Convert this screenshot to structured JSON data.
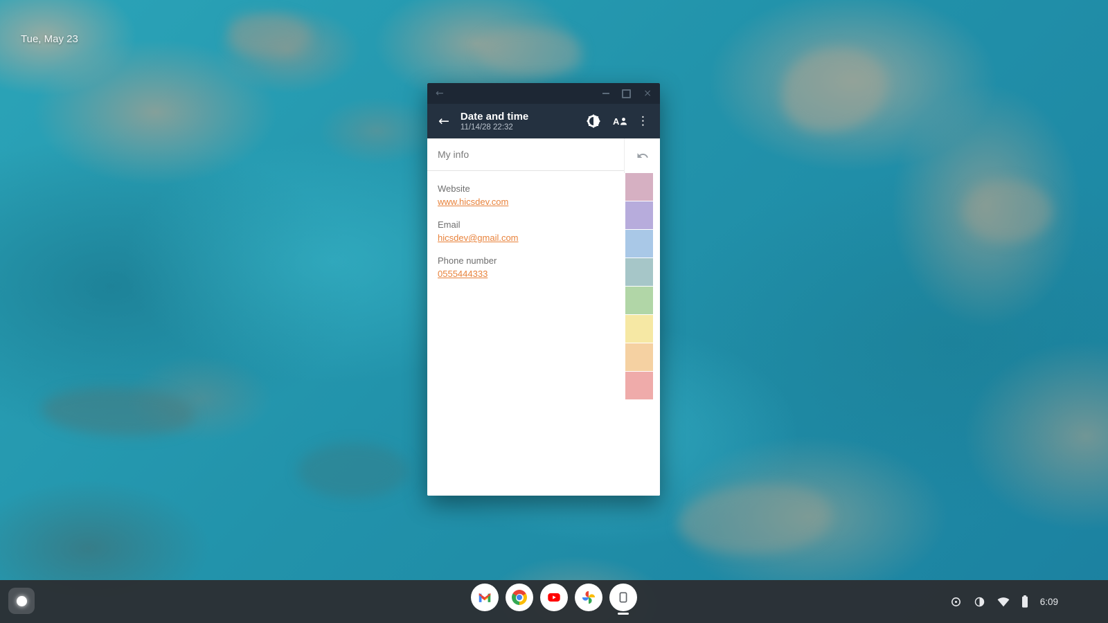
{
  "desktop": {
    "date": "Tue, May 23"
  },
  "glyphs": {
    "back": "←",
    "close": "×",
    "overflow": "⋮"
  },
  "colors": {
    "appbar_bg": "#243140",
    "caption_bg": "#1d2734",
    "link": "#e8823b",
    "shelf_bg": "#2c2f33"
  },
  "window": {
    "caption_icons": [
      "back-icon",
      "minimize-icon",
      "maximize-icon",
      "close-icon"
    ],
    "app_bar": {
      "title": "Date and time",
      "subtitle": "11/14/28 22:32",
      "action_icons": [
        "display-contrast-icon",
        "text-size-icon",
        "overflow-menu-icon"
      ]
    },
    "note": {
      "title_field": "My info",
      "body": [
        {
          "label": "Website",
          "link": "www.hicsdev.com"
        },
        {
          "label": "Email",
          "link": "hicsdev@gmail.com"
        },
        {
          "label": "Phone number",
          "link": "0555444333"
        }
      ],
      "rail_icon": "undo-icon",
      "palette": [
        "#d6b0c2",
        "#b7acdc",
        "#a9c8e7",
        "#a6c6c8",
        "#b1d6a7",
        "#f6e8a4",
        "#f5d1a2",
        "#efabaa"
      ]
    }
  },
  "shelf": {
    "launcher_icon": "launcher-icon",
    "apps": [
      {
        "name": "gmail"
      },
      {
        "name": "chrome"
      },
      {
        "name": "youtube"
      },
      {
        "name": "google-photos"
      },
      {
        "name": "notes",
        "active": true
      }
    ],
    "tray": {
      "icons": [
        "dial-icon",
        "contrast-icon",
        "wifi-icon",
        "battery-icon"
      ],
      "time": "6:09"
    }
  }
}
